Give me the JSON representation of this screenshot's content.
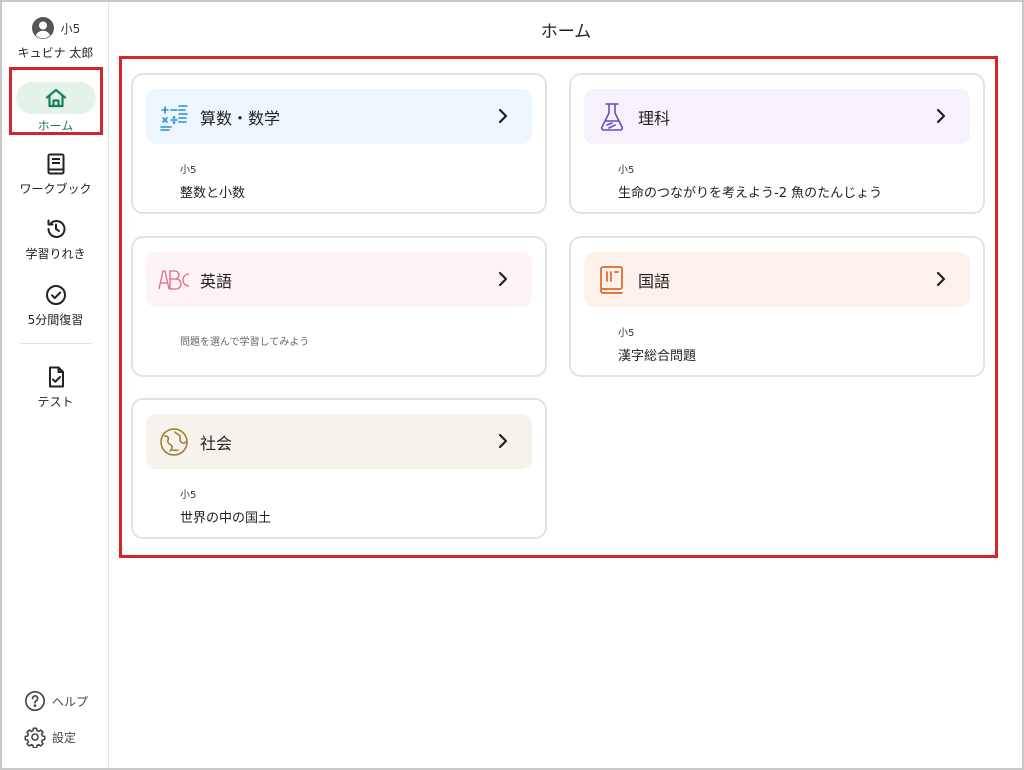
{
  "user": {
    "grade": "小5",
    "name": "キュビナ 太郎"
  },
  "nav": {
    "home": "ホーム",
    "workbook": "ワークブック",
    "history": "学習りれき",
    "review": "5分間復習",
    "test": "テスト"
  },
  "footer": {
    "help": "ヘルプ",
    "settings": "設定"
  },
  "page_title": "ホーム",
  "subjects": {
    "math": {
      "name": "算数・数学",
      "grade": "小5",
      "topic": "整数と小数",
      "icon": "math-symbols-icon",
      "band_color": "#eef6fd"
    },
    "science": {
      "name": "理科",
      "grade": "小5",
      "topic": "生命のつながりを考えよう-2 魚のたんじょう",
      "icon": "flask-icon",
      "band_color": "#f6f1fb"
    },
    "english": {
      "name": "英語",
      "hint": "問題を選んで学習してみよう",
      "icon": "abc-icon",
      "band_color": "#fdf3f5"
    },
    "japanese": {
      "name": "国語",
      "grade": "小5",
      "topic": "漢字総合問題",
      "icon": "book-icon",
      "band_color": "#fdf1ec"
    },
    "social": {
      "name": "社会",
      "grade": "小5",
      "topic": "世界の中の国土",
      "icon": "globe-icon",
      "band_color": "#f5f3ec"
    }
  },
  "colors": {
    "accent": "#15835a",
    "annotation": "#d7232a"
  }
}
